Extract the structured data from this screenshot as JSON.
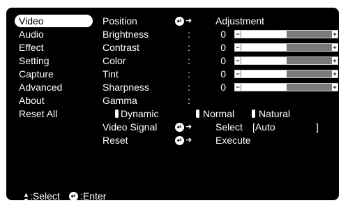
{
  "menu": {
    "items": [
      {
        "label": "Video",
        "selected": true
      },
      {
        "label": "Audio"
      },
      {
        "label": "Effect"
      },
      {
        "label": "Setting"
      },
      {
        "label": "Capture"
      },
      {
        "label": "Advanced"
      },
      {
        "label": "About"
      },
      {
        "label": "Reset All"
      }
    ]
  },
  "position": {
    "label": "Position",
    "action": "Adjustment"
  },
  "sliders": [
    {
      "label": "Brightness",
      "value": "0",
      "level": 0.5
    },
    {
      "label": "Contrast",
      "value": "0",
      "level": 0.5
    },
    {
      "label": "Color",
      "value": "0",
      "level": 0.5
    },
    {
      "label": "Tint",
      "value": "0",
      "level": 0.5
    },
    {
      "label": "Sharpness",
      "value": "0",
      "level": 0.5
    }
  ],
  "gamma": {
    "label": "Gamma",
    "options": [
      "Dynamic",
      "Normal",
      "Natural"
    ]
  },
  "video_signal": {
    "label": "Video Signal",
    "action": "Select",
    "value": "[Auto",
    "bracket_close": "]"
  },
  "reset": {
    "label": "Reset",
    "action": "Execute"
  },
  "footer": {
    "select_label": ":Select",
    "enter_label": ":Enter"
  },
  "colon": ":"
}
